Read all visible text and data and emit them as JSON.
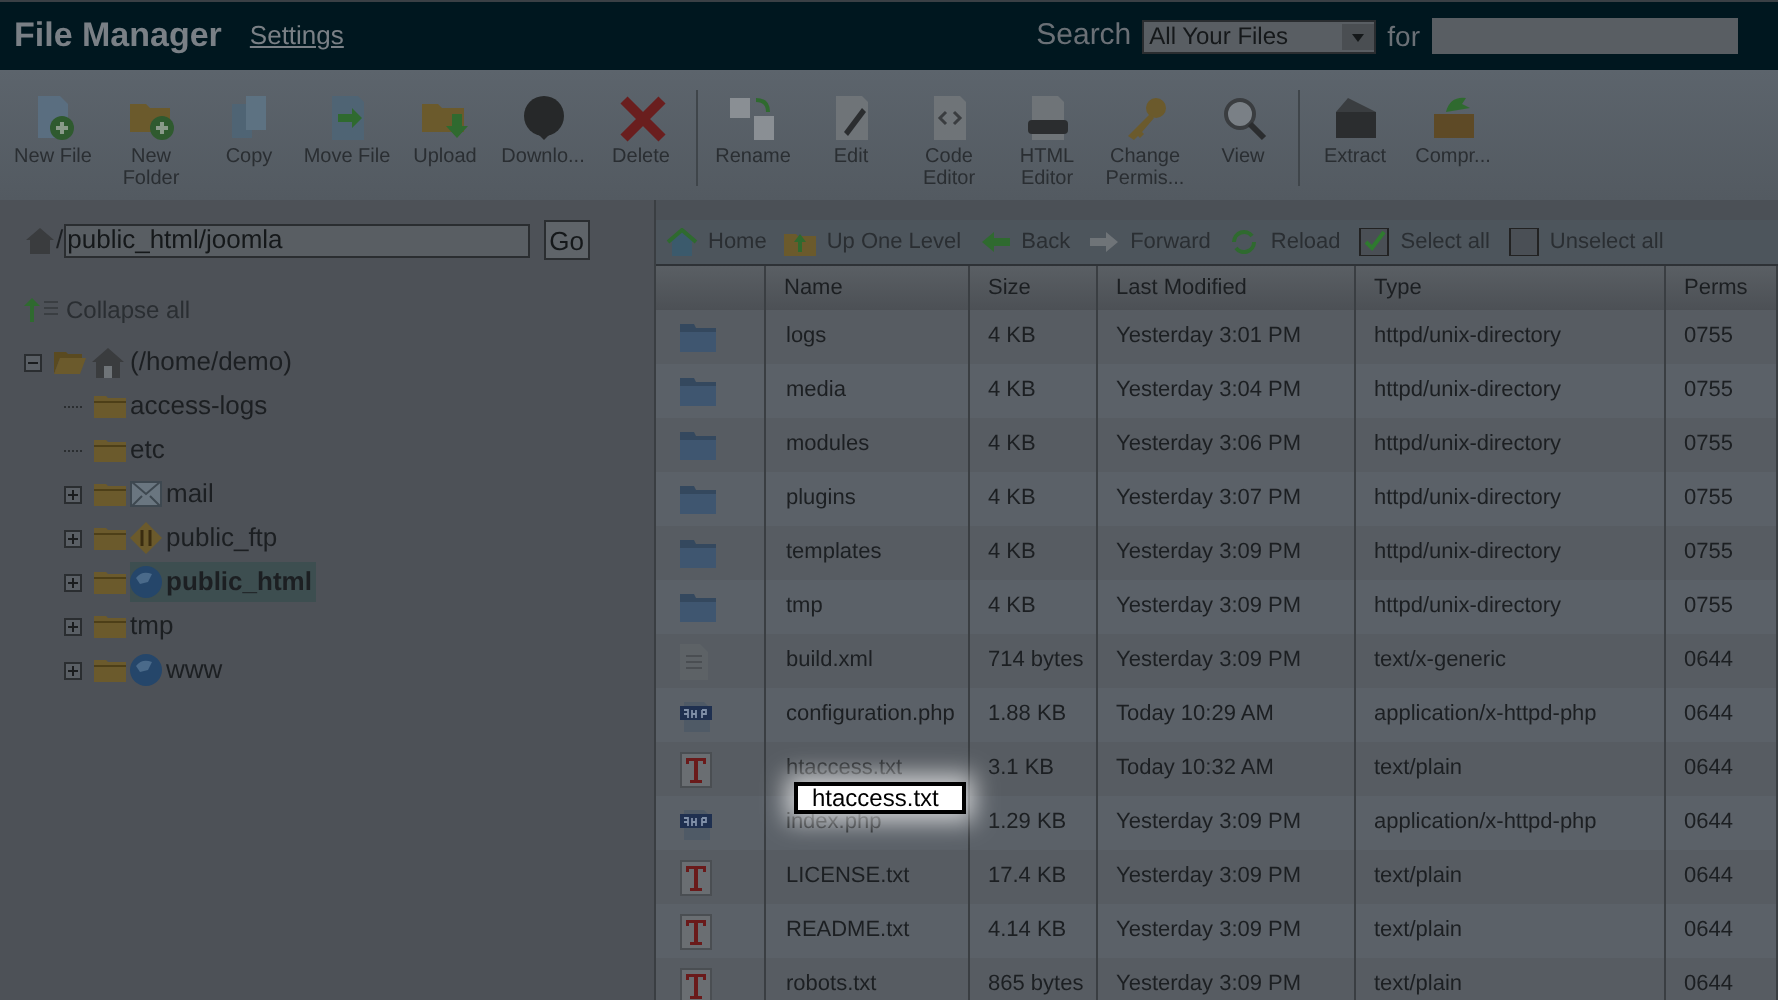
{
  "header": {
    "title": "File Manager",
    "settings_link": "Settings",
    "search_label": "Search",
    "search_scope": "All Your Files",
    "for_label": "for"
  },
  "toolbar": [
    {
      "kind": "newfile",
      "label": "New File"
    },
    {
      "kind": "newfolder",
      "label": "New Folder"
    },
    {
      "kind": "copy",
      "label": "Copy"
    },
    {
      "kind": "move",
      "label": "Move File"
    },
    {
      "kind": "upload",
      "label": "Upload"
    },
    {
      "kind": "download",
      "label": "Downlo..."
    },
    {
      "kind": "delete",
      "label": "Delete"
    },
    {
      "kind": "separator"
    },
    {
      "kind": "rename",
      "label": "Rename"
    },
    {
      "kind": "edit",
      "label": "Edit"
    },
    {
      "kind": "code",
      "label": "Code Editor"
    },
    {
      "kind": "html",
      "label": "HTML Editor"
    },
    {
      "kind": "perms",
      "label": "Change Permis..."
    },
    {
      "kind": "view",
      "label": "View"
    },
    {
      "kind": "separator"
    },
    {
      "kind": "extract",
      "label": "Extract"
    },
    {
      "kind": "compress",
      "label": "Compr..."
    }
  ],
  "path": {
    "separator": "/",
    "value": "public_html/joomla",
    "go": "Go"
  },
  "collapse_all": "Collapse all",
  "tree": [
    {
      "label": "(/home/demo)",
      "kind": "home",
      "expanded": true,
      "selected": false,
      "children": [
        {
          "label": "access-logs",
          "kind": "folder",
          "expandable": false,
          "selected": false
        },
        {
          "label": "etc",
          "kind": "folder",
          "expandable": false,
          "selected": false
        },
        {
          "label": "mail",
          "kind": "mail",
          "expandable": true,
          "selected": false
        },
        {
          "label": "public_ftp",
          "kind": "ftp",
          "expandable": true,
          "selected": false
        },
        {
          "label": "public_html",
          "kind": "web",
          "expandable": true,
          "selected": true
        },
        {
          "label": "tmp",
          "kind": "folder",
          "expandable": true,
          "selected": false
        },
        {
          "label": "www",
          "kind": "web",
          "expandable": true,
          "selected": false
        }
      ]
    }
  ],
  "nav": [
    {
      "kind": "home",
      "label": "Home"
    },
    {
      "kind": "up",
      "label": "Up One Level"
    },
    {
      "kind": "back",
      "label": "Back"
    },
    {
      "kind": "forward",
      "label": "Forward"
    },
    {
      "kind": "reload",
      "label": "Reload"
    },
    {
      "kind": "selectall",
      "label": "Select all"
    },
    {
      "kind": "unselectall",
      "label": "Unselect all"
    }
  ],
  "table": {
    "columns": [
      "Name",
      "Size",
      "Last Modified",
      "Type",
      "Perms"
    ],
    "rows": [
      {
        "kind": "folder",
        "name": "logs",
        "size": "4 KB",
        "modified": "Yesterday 3:01 PM",
        "type": "httpd/unix-directory",
        "perms": "0755"
      },
      {
        "kind": "folder",
        "name": "media",
        "size": "4 KB",
        "modified": "Yesterday 3:04 PM",
        "type": "httpd/unix-directory",
        "perms": "0755"
      },
      {
        "kind": "folder",
        "name": "modules",
        "size": "4 KB",
        "modified": "Yesterday 3:06 PM",
        "type": "httpd/unix-directory",
        "perms": "0755"
      },
      {
        "kind": "folder",
        "name": "plugins",
        "size": "4 KB",
        "modified": "Yesterday 3:07 PM",
        "type": "httpd/unix-directory",
        "perms": "0755"
      },
      {
        "kind": "folder",
        "name": "templates",
        "size": "4 KB",
        "modified": "Yesterday 3:09 PM",
        "type": "httpd/unix-directory",
        "perms": "0755"
      },
      {
        "kind": "folder",
        "name": "tmp",
        "size": "4 KB",
        "modified": "Yesterday 3:09 PM",
        "type": "httpd/unix-directory",
        "perms": "0755"
      },
      {
        "kind": "generic",
        "name": "build.xml",
        "size": "714 bytes",
        "modified": "Yesterday 3:09 PM",
        "type": "text/x-generic",
        "perms": "0644"
      },
      {
        "kind": "php",
        "name": "configuration.php",
        "size": "1.88 KB",
        "modified": "Today 10:29 AM",
        "type": "application/x-httpd-php",
        "perms": "0644"
      },
      {
        "kind": "text",
        "name": "htaccess.txt",
        "size": "3.1 KB",
        "modified": "Today 10:32 AM",
        "type": "text/plain",
        "perms": "0644"
      },
      {
        "kind": "php",
        "name": "index.php",
        "size": "1.29 KB",
        "modified": "Yesterday 3:09 PM",
        "type": "application/x-httpd-php",
        "perms": "0644"
      },
      {
        "kind": "text",
        "name": "LICENSE.txt",
        "size": "17.4 KB",
        "modified": "Yesterday 3:09 PM",
        "type": "text/plain",
        "perms": "0644"
      },
      {
        "kind": "text",
        "name": "README.txt",
        "size": "4.14 KB",
        "modified": "Yesterday 3:09 PM",
        "type": "text/plain",
        "perms": "0644"
      },
      {
        "kind": "text",
        "name": "robots.txt",
        "size": "865 bytes",
        "modified": "Yesterday 3:09 PM",
        "type": "text/plain",
        "perms": "0644"
      }
    ]
  },
  "rename_field": {
    "value": "htaccess.txt"
  }
}
